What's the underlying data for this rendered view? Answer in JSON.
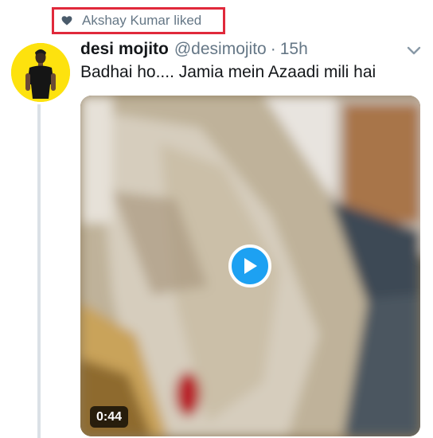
{
  "social_context": {
    "text": "Akshay Kumar liked",
    "icon": "heart-icon"
  },
  "tweet": {
    "display_name": "desi mojito",
    "handle": "@desimojito",
    "separator": "·",
    "time": "15h",
    "text": "Badhai ho.... Jamia mein Azaadi mili hai",
    "media": {
      "type": "video",
      "duration": "0:44",
      "icon": "play-icon"
    }
  },
  "colors": {
    "highlight_border": "#e0293b",
    "accent": "#1da1f2",
    "secondary_text": "#657786",
    "avatar_bg": "#fde20e"
  }
}
